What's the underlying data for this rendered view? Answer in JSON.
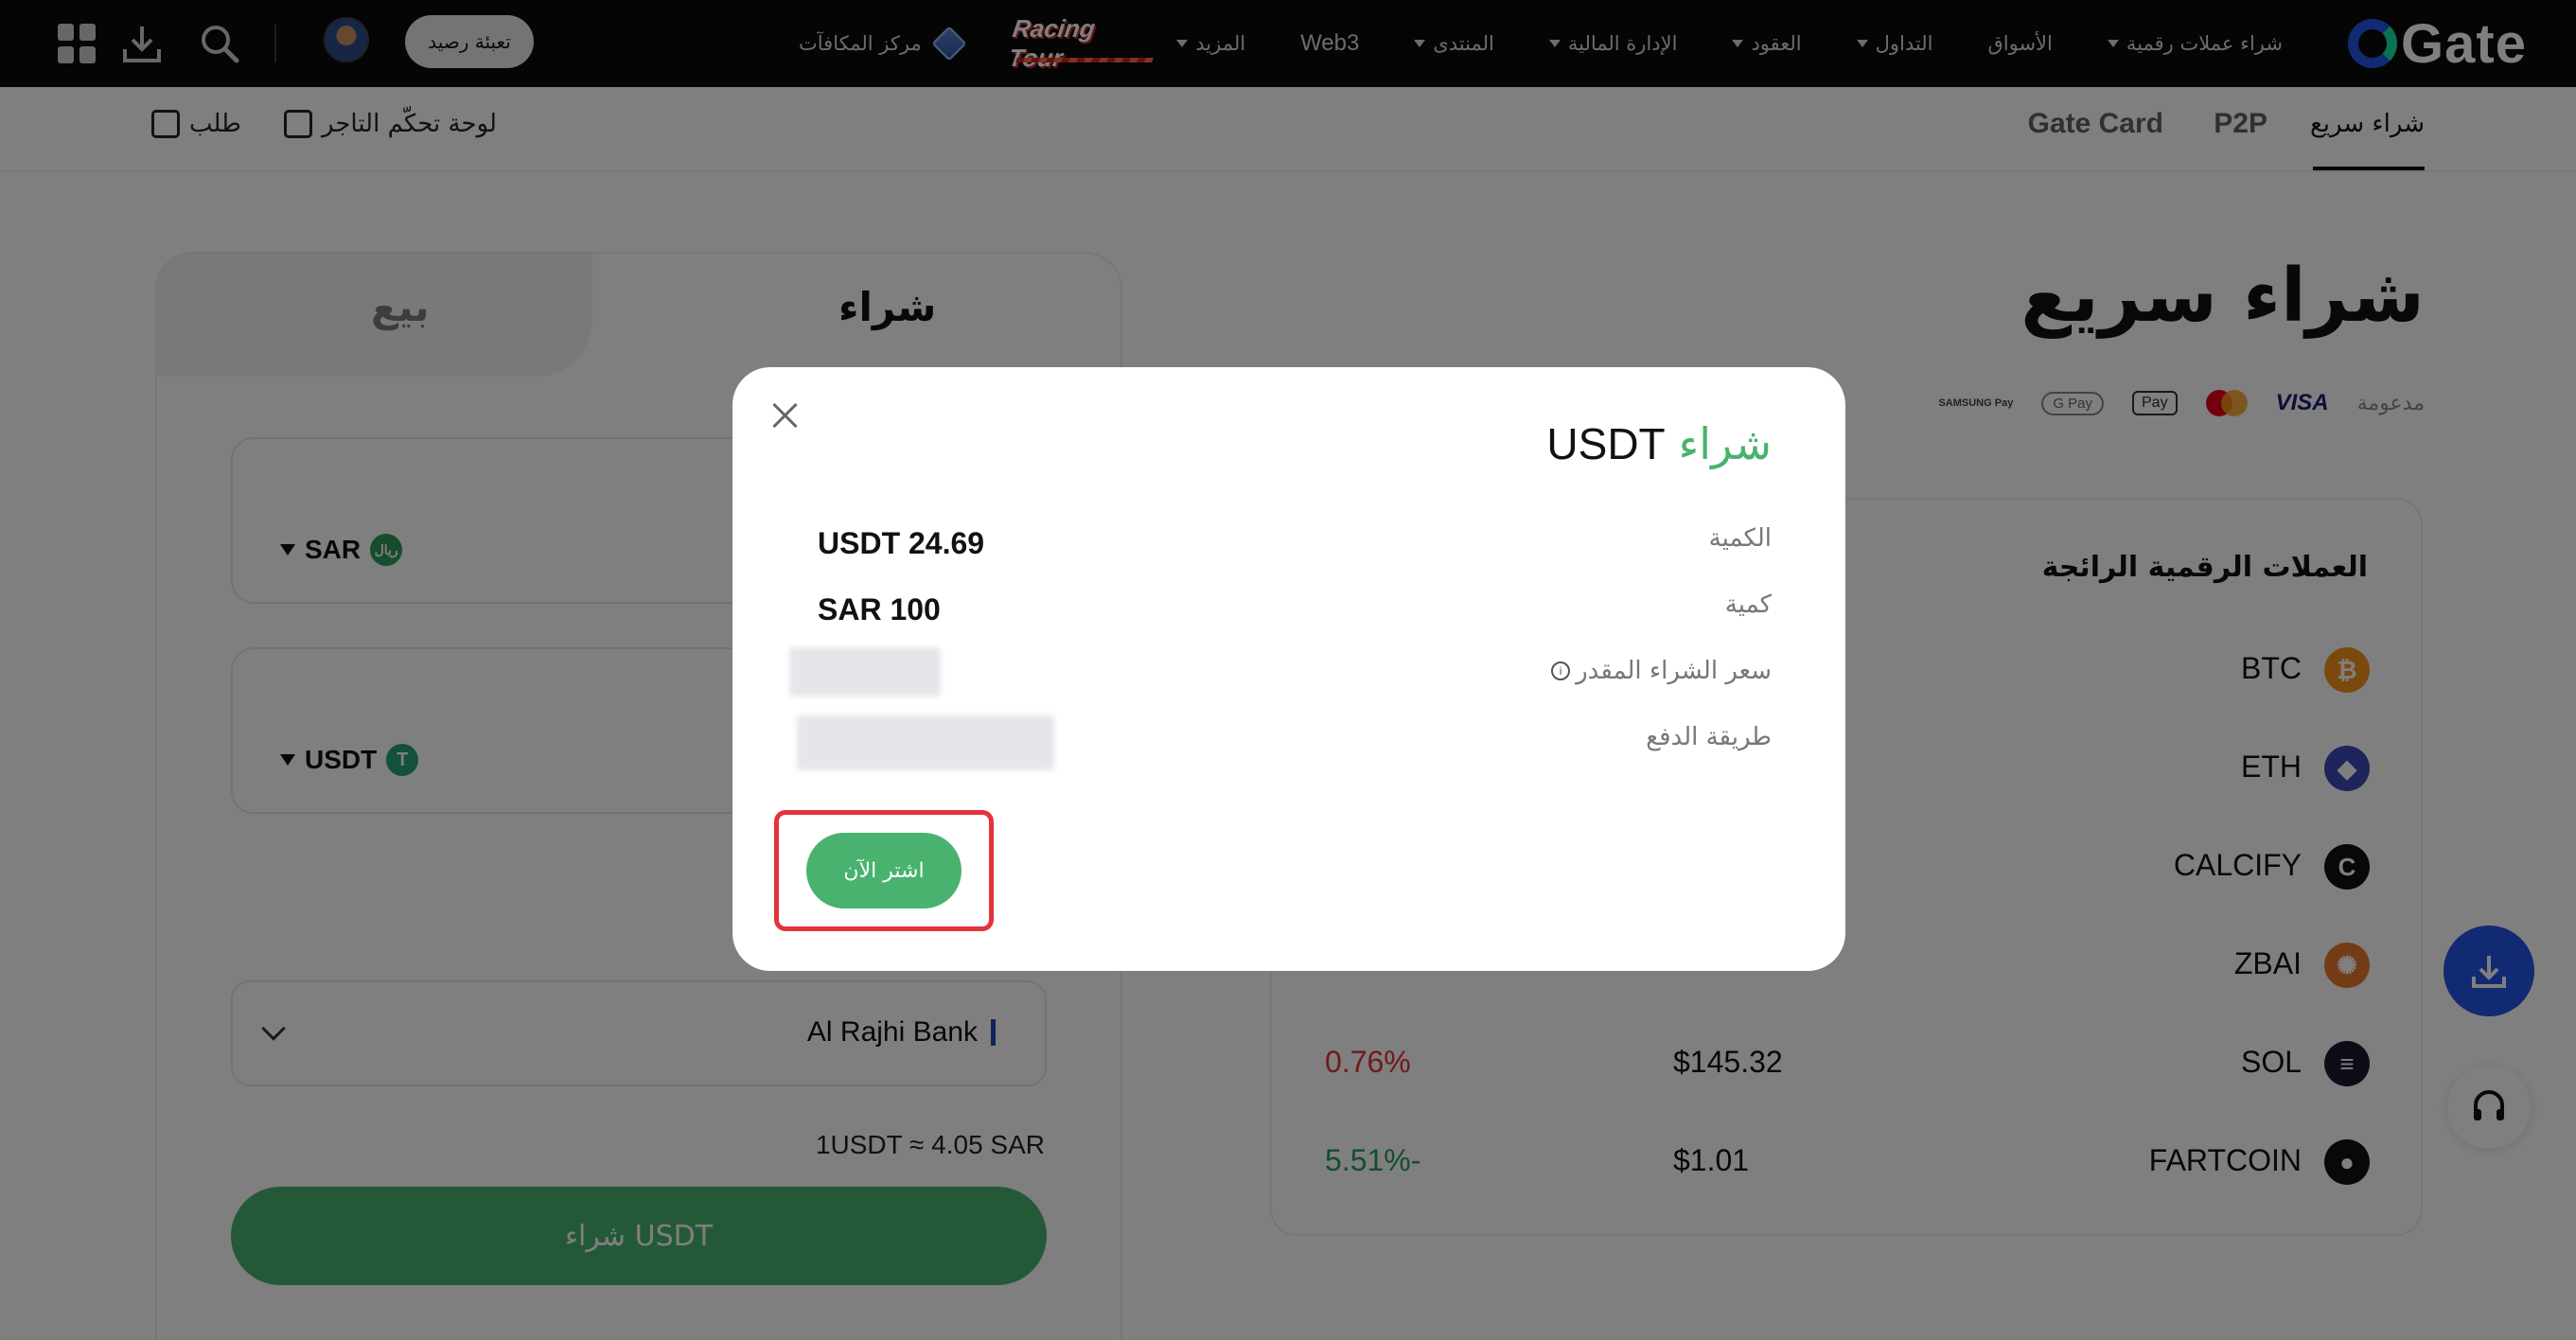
{
  "nav": {
    "brand": "Gate",
    "links": [
      {
        "label": "شراء عملات رقمية",
        "dropdown": true
      },
      {
        "label": "الأسواق",
        "dropdown": false
      },
      {
        "label": "التداول",
        "dropdown": true
      },
      {
        "label": "العقود",
        "dropdown": true
      },
      {
        "label": "الإدارة المالية",
        "dropdown": true
      },
      {
        "label": "المنتدى",
        "dropdown": true
      },
      {
        "label": "Web3",
        "dropdown": false
      },
      {
        "label": "المزيد",
        "dropdown": true
      }
    ],
    "racing": "Racing Tour",
    "rewards": "مركز المكافآت",
    "deposit": "تعبئة رصيد",
    "icons": [
      "grid-icon",
      "download-icon",
      "search-icon"
    ]
  },
  "subnav": {
    "tabs": [
      "شراء سريع",
      "P2P",
      "Gate Card"
    ],
    "active_tab": "شراء سريع",
    "merchant": "لوحة تحكّم التاجر",
    "orders": "طلب"
  },
  "page": {
    "title": "شراء سريع",
    "supported_label": "مدعومة",
    "payment_methods": [
      "VISA",
      "mastercard",
      "Pay",
      "G Pay",
      "SAMSUNG Pay"
    ]
  },
  "trending": {
    "title": "العملات الرقمية الرائجة",
    "coins": [
      {
        "symbol": "BTC",
        "price": "",
        "change": "",
        "color": "#f7931a",
        "glyph": "₿"
      },
      {
        "symbol": "ETH",
        "price": "",
        "change": "",
        "color": "#3d4ab8",
        "glyph": "◆"
      },
      {
        "symbol": "CALCIFY",
        "price": "",
        "change": "",
        "color": "#111111",
        "glyph": "C"
      },
      {
        "symbol": "ZBAI",
        "price": "",
        "change": "",
        "color": "#e9792b",
        "glyph": "✺"
      },
      {
        "symbol": "SOL",
        "price": "$145.32",
        "change": "0.76%",
        "change_color": "#e5323b",
        "color": "#1a1a2e",
        "glyph": "≡"
      },
      {
        "symbol": "FARTCOIN",
        "price": "$1.01",
        "change": "5.51%-",
        "change_color": "#2a9a5a",
        "color": "#111111",
        "glyph": "●"
      }
    ]
  },
  "trade": {
    "buy_tab": "شراء",
    "sell_tab": "بيع",
    "pay_currency": "SAR",
    "pay_badge": "ريال",
    "receive_currency": "USDT",
    "receive_badge": "T",
    "bank": "Al Rajhi Bank",
    "rate": "1USDT ≈ 4.05 SAR",
    "buy_button": "شراء USDT"
  },
  "modal": {
    "action": "شراء",
    "coin": "USDT",
    "rows": [
      {
        "label": "الكمية",
        "value": "USDT 24.69"
      },
      {
        "label": "كمية",
        "value": "SAR 100"
      },
      {
        "label": "سعر الشراء المقدر",
        "value": ""
      },
      {
        "label": "طريقة الدفع",
        "value": ""
      }
    ],
    "confirm": "اشتر الآن"
  },
  "colors": {
    "accent_green": "#49b26f",
    "brand_blue": "#2354e6",
    "highlight_red": "#e5323b"
  }
}
